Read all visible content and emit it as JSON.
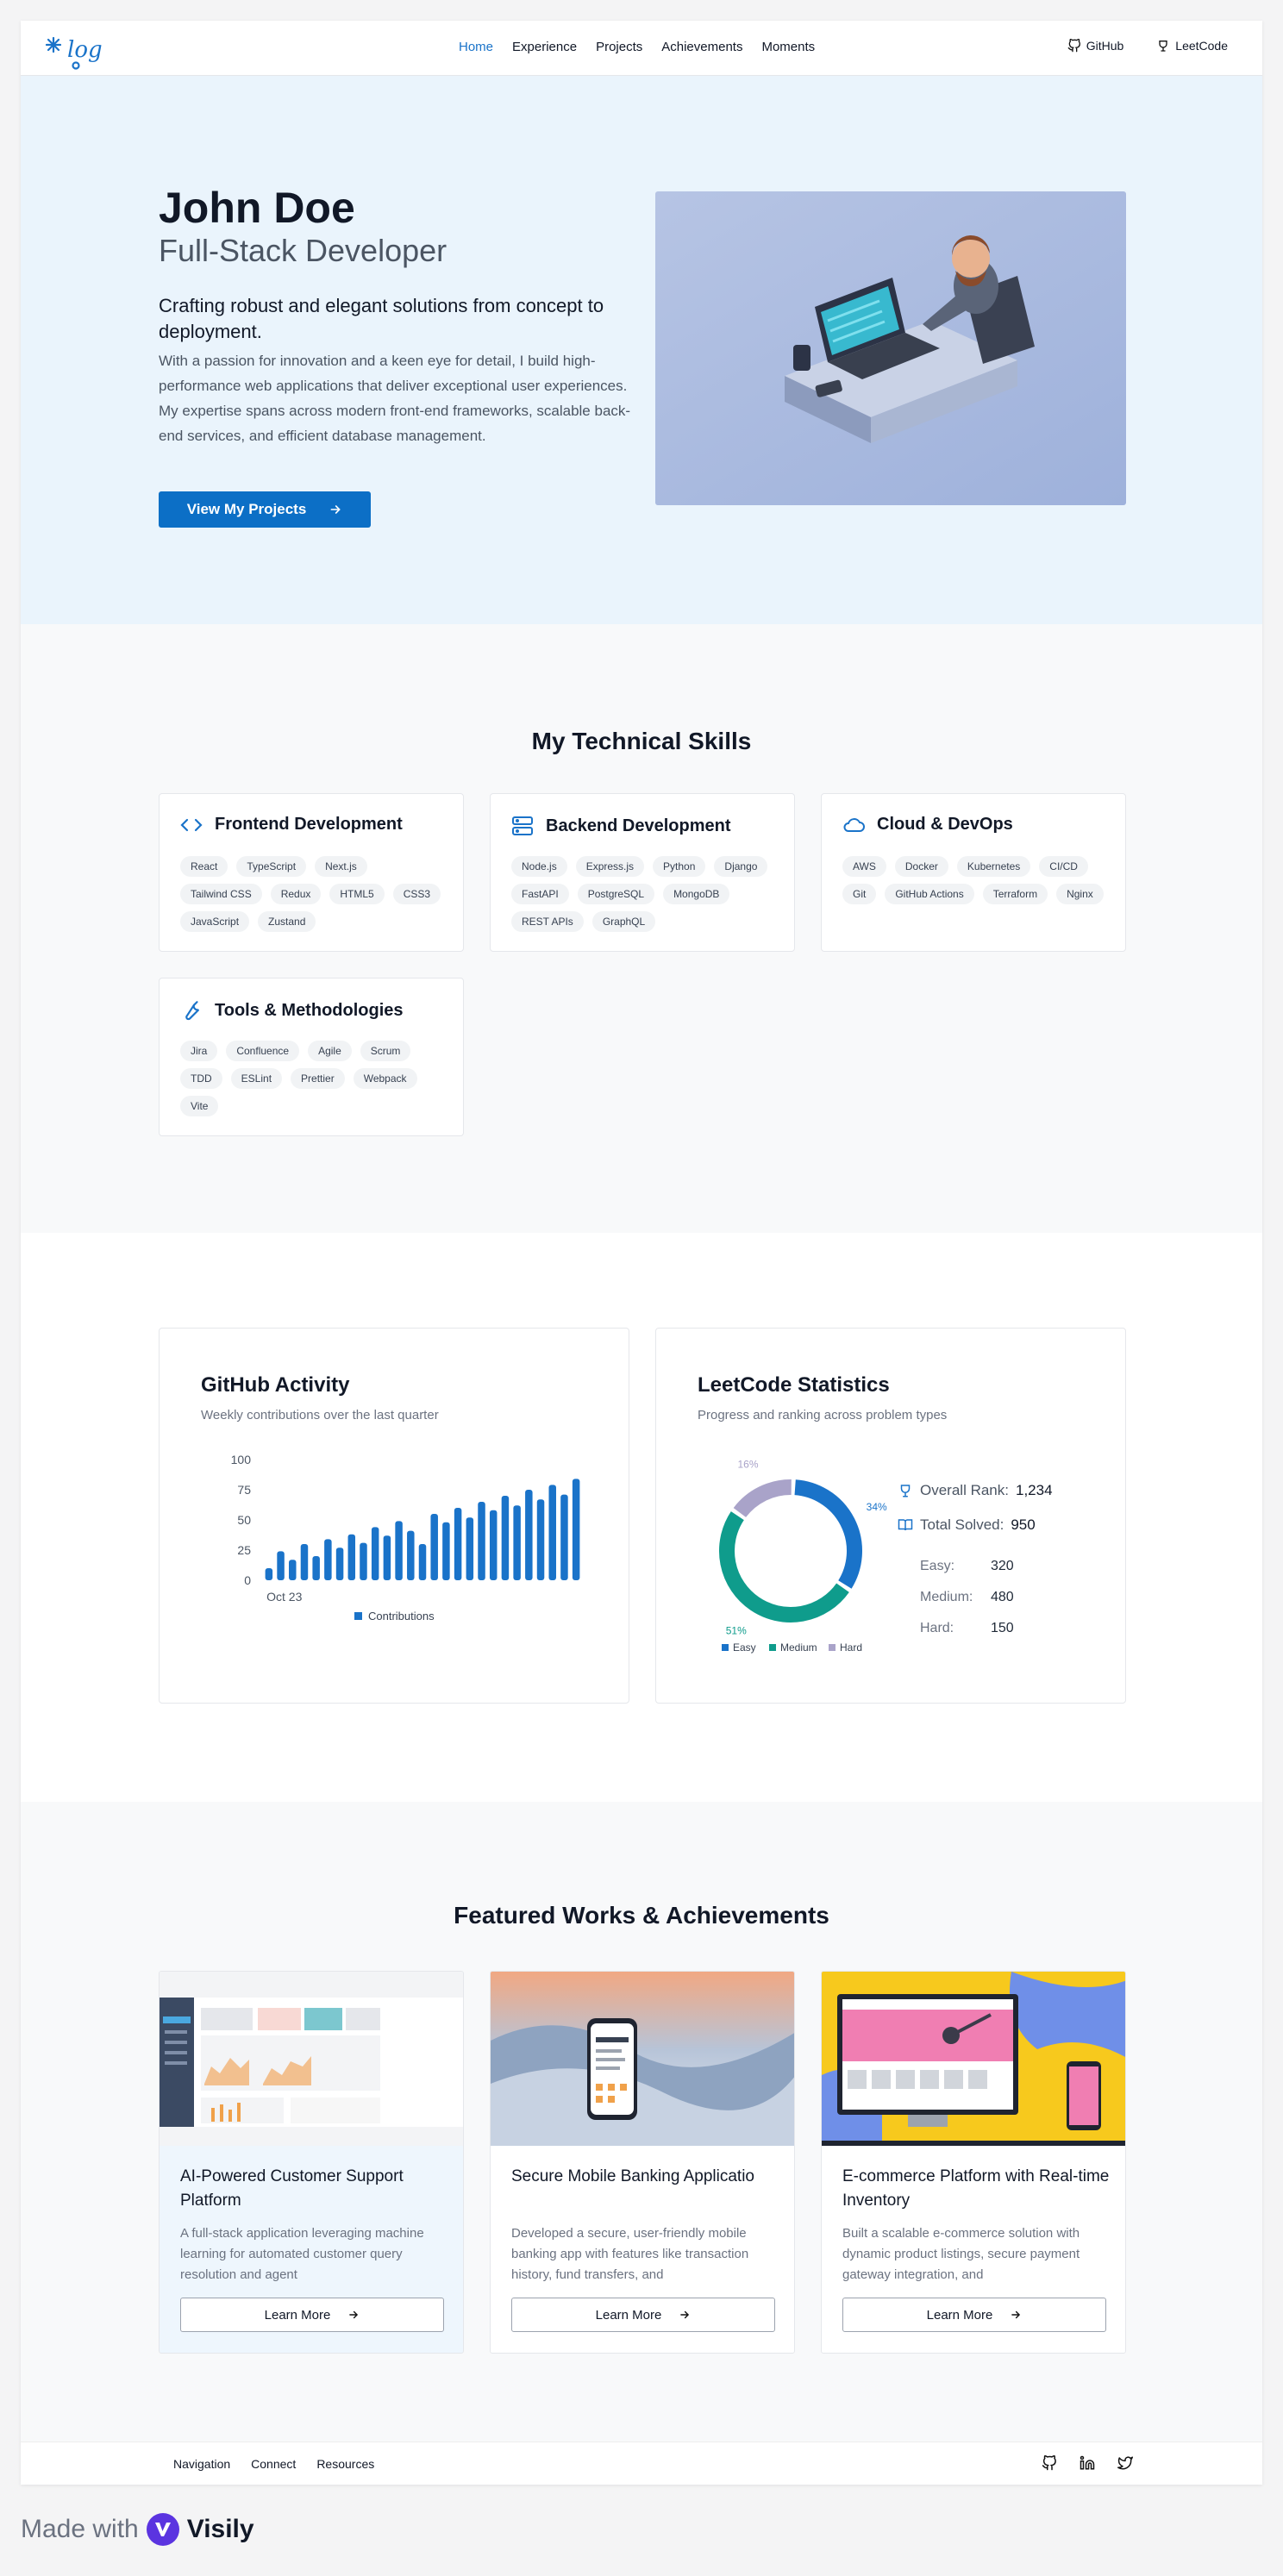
{
  "nav": {
    "links": [
      "Home",
      "Experience",
      "Projects",
      "Achievements",
      "Moments"
    ],
    "github": "GitHub",
    "leetcode": "LeetCode",
    "logo_text": "log"
  },
  "hero": {
    "name": "John Doe",
    "role": "Full-Stack Developer",
    "tagline": "Crafting robust and elegant solutions from concept to deployment.",
    "description": "With a passion for innovation and a keen eye for detail, I build high-performance web applications that deliver exceptional user experiences. My expertise spans across modern front-end frameworks, scalable back-end services, and efficient database management.",
    "cta": "View My Projects"
  },
  "skills": {
    "title": "My Technical Skills",
    "cards": [
      {
        "title": "Frontend Development",
        "icon": "code-icon",
        "tags": [
          "React",
          "TypeScript",
          "Next.js",
          "Tailwind CSS",
          "Redux",
          "HTML5",
          "CSS3",
          "JavaScript",
          "Zustand"
        ]
      },
      {
        "title": "Backend Development",
        "icon": "server-icon",
        "tags": [
          "Node.js",
          "Express.js",
          "Python",
          "Django",
          "FastAPI",
          "PostgreSQL",
          "MongoDB",
          "REST APIs",
          "GraphQL"
        ]
      },
      {
        "title": "Cloud & DevOps",
        "icon": "cloud-icon",
        "tags": [
          "AWS",
          "Docker",
          "Kubernetes",
          "CI/CD",
          "Git",
          "GitHub Actions",
          "Terraform",
          "Nginx"
        ]
      },
      {
        "title": "Tools & Methodologies",
        "icon": "wrench-icon",
        "tags": [
          "Jira",
          "Confluence",
          "Agile",
          "Scrum",
          "TDD",
          "ESLint",
          "Prettier",
          "Webpack",
          "Vite"
        ]
      }
    ]
  },
  "github": {
    "title": "GitHub Activity",
    "subtitle": "Weekly contributions over the last quarter"
  },
  "leetcode": {
    "title": "LeetCode Statistics",
    "subtitle": "Progress and ranking across problem types",
    "rank_label": "Overall Rank:",
    "rank_value": "1,234",
    "solved_label": "Total Solved:",
    "solved_value": "950",
    "rows": [
      {
        "label": "Easy:",
        "value": "320"
      },
      {
        "label": "Medium:",
        "value": "480"
      },
      {
        "label": "Hard:",
        "value": "150"
      }
    ]
  },
  "chart_data": [
    {
      "type": "bar",
      "x_tick_labels": [
        "Oct 23"
      ],
      "series": [
        {
          "name": "Contributions",
          "color": "#1a73c9",
          "values": [
            10,
            24,
            17,
            30,
            20,
            34,
            27,
            38,
            31,
            44,
            37,
            49,
            41,
            30,
            55,
            48,
            60,
            52,
            65,
            58,
            70,
            62,
            75,
            67,
            79,
            71,
            84
          ]
        }
      ],
      "ylim": [
        0,
        100
      ],
      "yticks": [
        0,
        25,
        50,
        75,
        100
      ],
      "grid": false,
      "legend": "bottom"
    },
    {
      "type": "pie",
      "donut": true,
      "categories": [
        "Easy",
        "Medium",
        "Hard"
      ],
      "values": [
        34,
        51,
        16
      ],
      "labels": [
        "34%",
        "51%",
        "16%"
      ],
      "colors": [
        "#1a73c9",
        "#0f9c8c",
        "#a9a3c9"
      ],
      "legend": "bottom"
    }
  ],
  "works": {
    "title": "Featured Works & Achievements",
    "items": [
      {
        "title": "AI-Powered Customer Support Platform",
        "desc": "A full-stack application leveraging machine learning for automated customer query resolution and agent",
        "button": "Learn More"
      },
      {
        "title": "Secure Mobile Banking Applicatio",
        "desc": "Developed a secure, user-friendly mobile banking app with features like transaction history, fund transfers, and",
        "button": "Learn More"
      },
      {
        "title": "E-commerce Platform with Real-time Inventory",
        "desc": "Built a scalable e-commerce solution with dynamic product listings, secure payment gateway integration, and",
        "button": "Learn More"
      }
    ]
  },
  "footer": {
    "links": [
      "Navigation",
      "Connect",
      "Resources"
    ]
  },
  "madewith": {
    "label": "Made with",
    "brand": "Visily"
  }
}
